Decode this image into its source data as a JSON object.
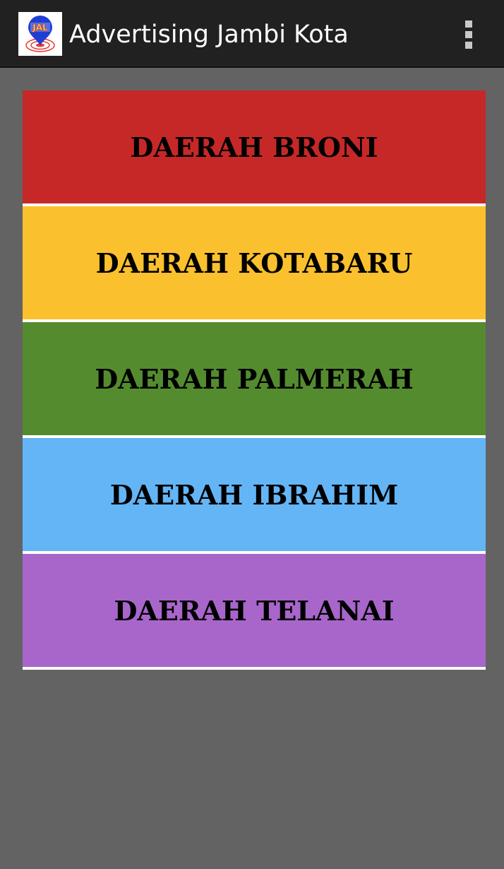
{
  "app": {
    "title": "Advertising Jambi Kota",
    "logo_text": "JAL",
    "icon": "app-logo-icon",
    "menu_icon": "overflow-menu-icon"
  },
  "regions": [
    {
      "label": "DAERAH BRONI",
      "color": "#c62828"
    },
    {
      "label": "DAERAH KOTABARU",
      "color": "#fbc02d"
    },
    {
      "label": "DAERAH PALMERAH",
      "color": "#558b2f"
    },
    {
      "label": "DAERAH IBRAHIM",
      "color": "#64b5f6"
    },
    {
      "label": "DAERAH TELANAI",
      "color": "#a866cb"
    }
  ],
  "colors": {
    "background": "#636363",
    "action_bar": "#212121",
    "divider": "#ffffff"
  }
}
